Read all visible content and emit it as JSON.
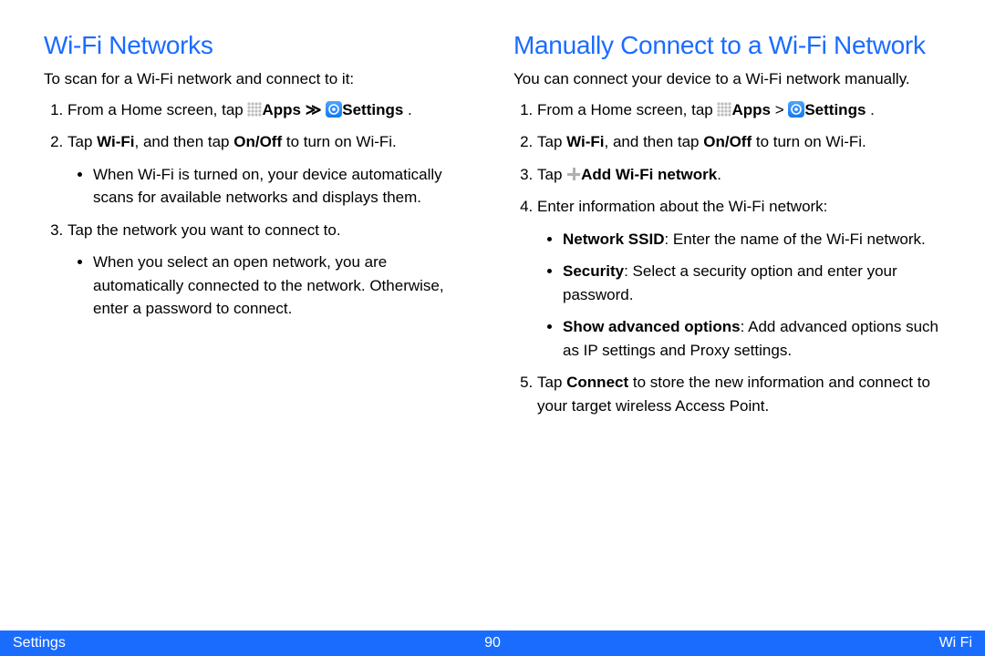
{
  "left": {
    "heading": "Wi-Fi Networks",
    "intro": "To scan for a Wi-Fi network and connect to it:",
    "step1_a": "From a Home screen, tap ",
    "step1_apps": "Apps",
    "step1_sep": " ",
    "step1_chev": "≫",
    "step1_settings": "Settings",
    "step1_end": " .",
    "step2_a": "Tap ",
    "step2_b": "Wi-Fi",
    "step2_c": ", and then tap ",
    "step2_d": "On/Off",
    "step2_e": " to turn on Wi-Fi.",
    "step2_bul": "When Wi-Fi is turned on, your device automatically scans for available networks and displays them.",
    "step3": "Tap the network you want to connect to.",
    "step3_bul": "When you select an open network, you are automatically connected to the network. Otherwise, enter a password to connect."
  },
  "right": {
    "heading": "Manually Connect to a Wi-Fi Network",
    "intro": "You can connect your device to a Wi-Fi network manually.",
    "step1_a": "From a Home screen, tap ",
    "step1_apps": "Apps",
    "step1_sep": " > ",
    "step1_settings": "Settings",
    "step1_end": " .",
    "step2_a": "Tap ",
    "step2_b": "Wi-Fi",
    "step2_c": ", and then tap ",
    "step2_d": "On/Off",
    "step2_e": " to turn on Wi-Fi.",
    "step3_a": "Tap ",
    "step3_b": "Add Wi-Fi network",
    "step3_c": ".",
    "step4": "Enter information about the Wi-Fi network:",
    "step4_b1a": "Network SSID",
    "step4_b1b": ": Enter the name of the Wi-Fi network.",
    "step4_b2a": "Security",
    "step4_b2b": ": Select a security option and enter your password.",
    "step4_b3a": "Show advanced options",
    "step4_b3b": ": Add advanced options such as IP settings and Proxy settings.",
    "step5_a": "Tap ",
    "step5_b": "Connect",
    "step5_c": " to store the new information and connect to your target wireless Access Point."
  },
  "footer": {
    "left": "Settings",
    "center": "90",
    "right": "Wi Fi"
  }
}
